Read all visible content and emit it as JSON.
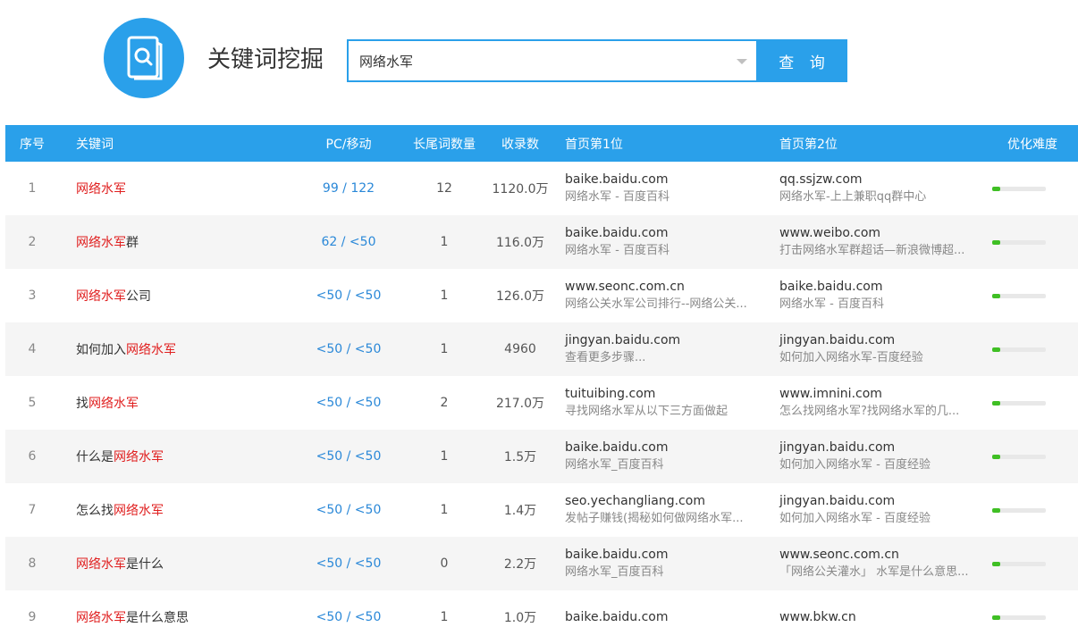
{
  "header": {
    "title": "关键词挖掘",
    "logo_icon": "magnifier-book-icon",
    "search_value": "网络水军",
    "search_button": "查 询",
    "accent_color": "#2aa0ea"
  },
  "table": {
    "columns": [
      "序号",
      "关键词",
      "PC/移动",
      "长尾词数量",
      "收录数",
      "首页第1位",
      "首页第2位",
      "优化难度"
    ],
    "rows": [
      {
        "no": "1",
        "kw_pre": "",
        "kw_hl": "网络水军",
        "kw_post": "",
        "pc": "99 / 122",
        "longtail": "12",
        "indexed": "1120.0万",
        "r1_site": "baike.baidu.com",
        "r1_snip": "网络水军 - 百度百科",
        "r2_site": "qq.ssjzw.com",
        "r2_snip": "网络水军-上上兼职qq群中心",
        "difficulty": 0.15
      },
      {
        "no": "2",
        "kw_pre": "",
        "kw_hl": "网络水军",
        "kw_post": "群",
        "pc": "62 / <50",
        "longtail": "1",
        "indexed": "116.0万",
        "r1_site": "baike.baidu.com",
        "r1_snip": "网络水军 - 百度百科",
        "r2_site": "www.weibo.com",
        "r2_snip": "打击网络水军群超话—新浪微博超...",
        "difficulty": 0.15
      },
      {
        "no": "3",
        "kw_pre": "",
        "kw_hl": "网络水军",
        "kw_post": "公司",
        "pc": "<50 / <50",
        "longtail": "1",
        "indexed": "126.0万",
        "r1_site": "www.seonc.com.cn",
        "r1_snip": "网络公关水军公司排行--网络公关...",
        "r2_site": "baike.baidu.com",
        "r2_snip": "网络水军 - 百度百科",
        "difficulty": 0.15
      },
      {
        "no": "4",
        "kw_pre": "如何加入",
        "kw_hl": "网络水军",
        "kw_post": "",
        "pc": "<50 / <50",
        "longtail": "1",
        "indexed": "4960",
        "r1_site": "jingyan.baidu.com",
        "r1_snip": "查看更多步骤...",
        "r2_site": "jingyan.baidu.com",
        "r2_snip": "如何加入网络水军-百度经验",
        "difficulty": 0.15
      },
      {
        "no": "5",
        "kw_pre": "找",
        "kw_hl": "网络水军",
        "kw_post": "",
        "pc": "<50 / <50",
        "longtail": "2",
        "indexed": "217.0万",
        "r1_site": "tuituibing.com",
        "r1_snip": "寻找网络水军从以下三方面做起",
        "r2_site": "www.imnini.com",
        "r2_snip": "怎么找网络水军?找网络水军的几...",
        "difficulty": 0.15
      },
      {
        "no": "6",
        "kw_pre": "什么是",
        "kw_hl": "网络水军",
        "kw_post": "",
        "pc": "<50 / <50",
        "longtail": "1",
        "indexed": "1.5万",
        "r1_site": "baike.baidu.com",
        "r1_snip": "网络水军_百度百科",
        "r2_site": "jingyan.baidu.com",
        "r2_snip": "如何加入网络水军 - 百度经验",
        "difficulty": 0.15
      },
      {
        "no": "7",
        "kw_pre": "怎么找",
        "kw_hl": "网络水军",
        "kw_post": "",
        "pc": "<50 / <50",
        "longtail": "1",
        "indexed": "1.4万",
        "r1_site": "seo.yechangliang.com",
        "r1_snip": "发帖子赚钱(揭秘如何做网络水军...",
        "r2_site": "jingyan.baidu.com",
        "r2_snip": "如何加入网络水军 - 百度经验",
        "difficulty": 0.15
      },
      {
        "no": "8",
        "kw_pre": "",
        "kw_hl": "网络水军",
        "kw_post": "是什么",
        "pc": "<50 / <50",
        "longtail": "0",
        "indexed": "2.2万",
        "r1_site": "baike.baidu.com",
        "r1_snip": "网络水军_百度百科",
        "r2_site": "www.seonc.com.cn",
        "r2_snip": "「网络公关灌水」 水军是什么意思...",
        "difficulty": 0.15
      },
      {
        "no": "9",
        "kw_pre": "",
        "kw_hl": "网络水军",
        "kw_post": "是什么意思",
        "pc": "<50 / <50",
        "longtail": "1",
        "indexed": "1.0万",
        "r1_site": "baike.baidu.com",
        "r1_snip": "",
        "r2_site": "www.bkw.cn",
        "r2_snip": "",
        "difficulty": 0.15
      }
    ]
  }
}
